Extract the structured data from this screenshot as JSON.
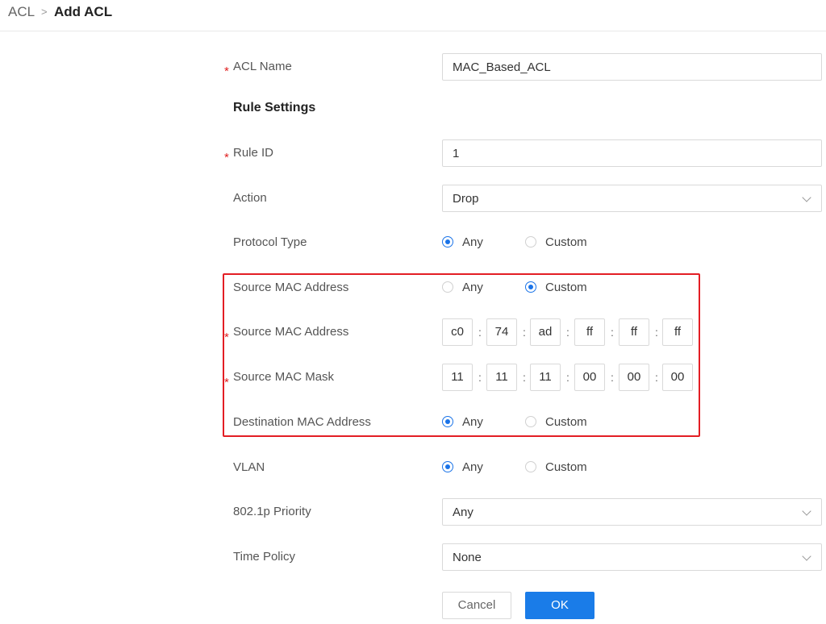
{
  "breadcrumb": {
    "root": "ACL",
    "separator": ">",
    "current": "Add ACL"
  },
  "required_marker": "*",
  "form": {
    "acl_name": {
      "label": "ACL Name",
      "value": "MAC_Based_ACL"
    },
    "rule_settings_title": "Rule Settings",
    "rule_id": {
      "label": "Rule ID",
      "value": "1"
    },
    "action": {
      "label": "Action",
      "value": "Drop"
    },
    "protocol_type": {
      "label": "Protocol Type",
      "options": [
        "Any",
        "Custom"
      ],
      "selected": "Any"
    },
    "source_mac_mode": {
      "label": "Source MAC Address",
      "options": [
        "Any",
        "Custom"
      ],
      "selected": "Custom"
    },
    "source_mac": {
      "label": "Source MAC Address",
      "octets": [
        "c0",
        "74",
        "ad",
        "ff",
        "ff",
        "ff"
      ]
    },
    "source_mac_mask": {
      "label": "Source MAC Mask",
      "octets": [
        "11",
        "11",
        "11",
        "00",
        "00",
        "00"
      ]
    },
    "destination_mac": {
      "label": "Destination MAC Address",
      "options": [
        "Any",
        "Custom"
      ],
      "selected": "Any"
    },
    "vlan": {
      "label": "VLAN",
      "options": [
        "Any",
        "Custom"
      ],
      "selected": "Any"
    },
    "priority_8021p": {
      "label": "802.1p Priority",
      "value": "Any"
    },
    "time_policy": {
      "label": "Time Policy",
      "value": "None"
    }
  },
  "colon": ":",
  "buttons": {
    "cancel": "Cancel",
    "ok": "OK"
  },
  "colors": {
    "accent": "#1a7ce8",
    "required": "#e02020",
    "highlight": "#e31e24"
  },
  "icons": {
    "select_arrow": "chevron-down-icon",
    "breadcrumb_separator": "chevron-right-icon"
  }
}
